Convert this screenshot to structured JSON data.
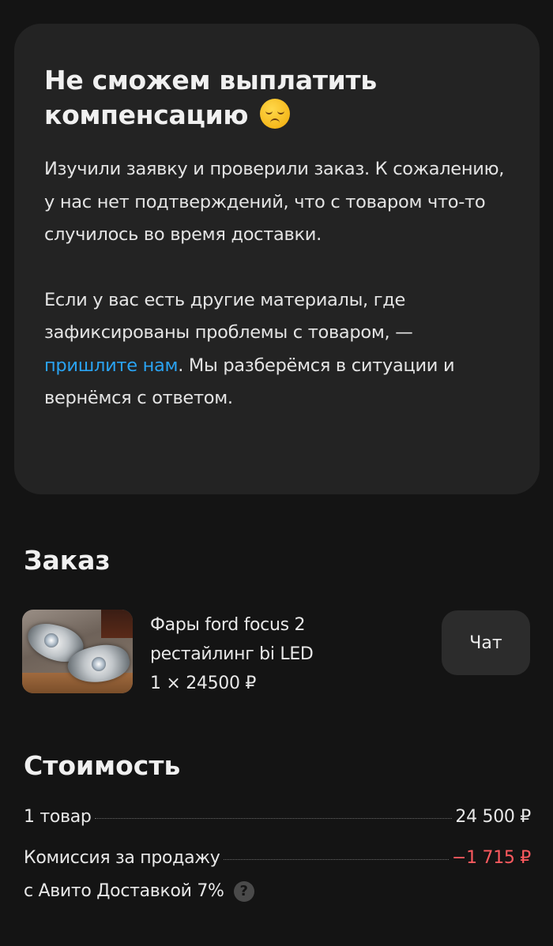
{
  "notice": {
    "title": "Не сможем выплатить компенсацию",
    "emoji_icon": "pensive-face-emoji",
    "paragraph1": "Изучили заявку и проверили заказ. К сожалению, у нас нет подтверждений, что с товаром что-то случилось во время доставки.",
    "paragraph2_before": "Если у вас есть другие материалы, где зафиксированы проблемы с товаром, — ",
    "paragraph2_link": "пришлите нам",
    "paragraph2_after": ". Мы разберёмся в ситуации и вернёмся с ответом."
  },
  "order": {
    "title": "Заказ",
    "product_name": "Фары ford focus 2 рестайлинг bi LED",
    "quantity_price": "1 × 24500 ₽",
    "chat_label": "Чат"
  },
  "cost": {
    "title": "Стоимость",
    "rows": [
      {
        "label": "1 товар",
        "value": "24 500 ₽"
      },
      {
        "label": "Комиссия за продажу с Авито Доставкой 7%",
        "value": "−1 715 ₽"
      }
    ]
  },
  "colors": {
    "background": "#141414",
    "card": "#232323",
    "link": "#2aa3f2",
    "negative": "#ff5a5f"
  }
}
